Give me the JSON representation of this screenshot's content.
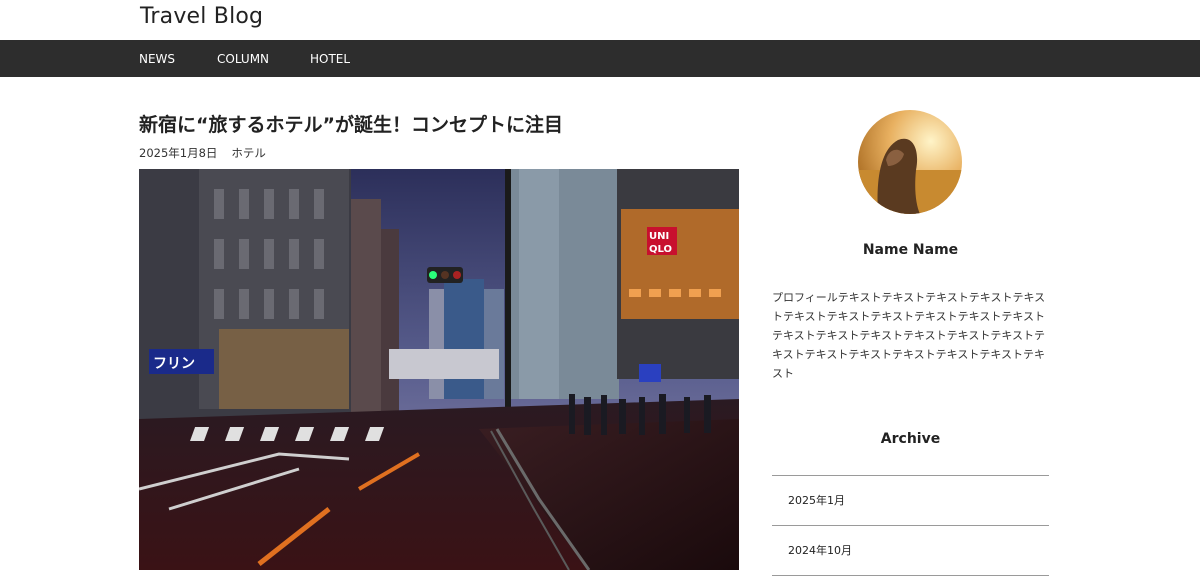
{
  "site": {
    "title": "Travel Blog"
  },
  "nav": {
    "items": [
      "NEWS",
      "COLUMN",
      "HOTEL"
    ]
  },
  "article": {
    "title": "新宿に“旅するホテル”が誕生！コンセプトに注目",
    "date": "2025年1月8日",
    "category": "ホテル",
    "photo_signs": {
      "sign1": "UNI",
      "sign2": "QLO",
      "sign3": "フリン"
    }
  },
  "sidebar": {
    "profile": {
      "name": "Name Name",
      "text": "プロフィールテキストテキストテキストテキストテキストテキストテキストテキストテキストテキストテキストテキストテキストテキストテキストテキストテキストテキストテキストテキストテキストテキストテキストテキスト"
    },
    "archive": {
      "heading": "Archive",
      "items": [
        "2025年1月",
        "2024年10月"
      ]
    }
  },
  "colors": {
    "nav_bg": "#2d2d2d",
    "accent_red": "#c8102e"
  }
}
